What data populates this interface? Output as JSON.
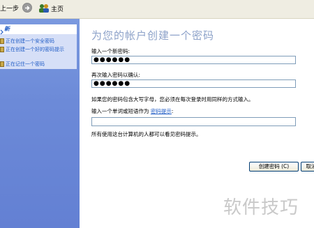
{
  "toolbar": {
    "back_label": "上一步",
    "forward_icon": "forward-arrow-icon",
    "home_icon": "users-home-icon",
    "home_label": "主页"
  },
  "task_pane": {
    "header_label": "新",
    "items": [
      {
        "label": "正在创建一个安全密码",
        "icon": "help-doc-icon"
      },
      {
        "label": "正在创建一个好的密码提示",
        "icon": "help-doc-icon"
      },
      {
        "label": "正在记住一个密码",
        "icon": "help-doc-icon"
      }
    ]
  },
  "main": {
    "title": "为您的帐户创建一个密码",
    "new_password_label": "输入一个新密码:",
    "new_password_value": "●●●●●●",
    "confirm_password_label": "再次输入密码以确认:",
    "confirm_password_value": "●●●●●●",
    "case_note": "如果您的密码包含大写字母，您必须在每次登录时用同样的方式输入。",
    "hint_label_prefix": "输入一个单词或短语作为",
    "hint_link": "密码提示",
    "hint_label_suffix": ":",
    "hint_value": "",
    "hint_visibility_note": "所有使用这台计算机的人都可以看见密码提示。",
    "create_button": "创建密码 (C)",
    "cancel_button": "取消"
  },
  "watermark": "软件技巧",
  "colors": {
    "toolbar_bg": "#efede2",
    "task_pane_bg": "#7a99df",
    "task_box_bg": "#d6dff7",
    "link": "#215dc6",
    "title": "#8da2c9"
  }
}
